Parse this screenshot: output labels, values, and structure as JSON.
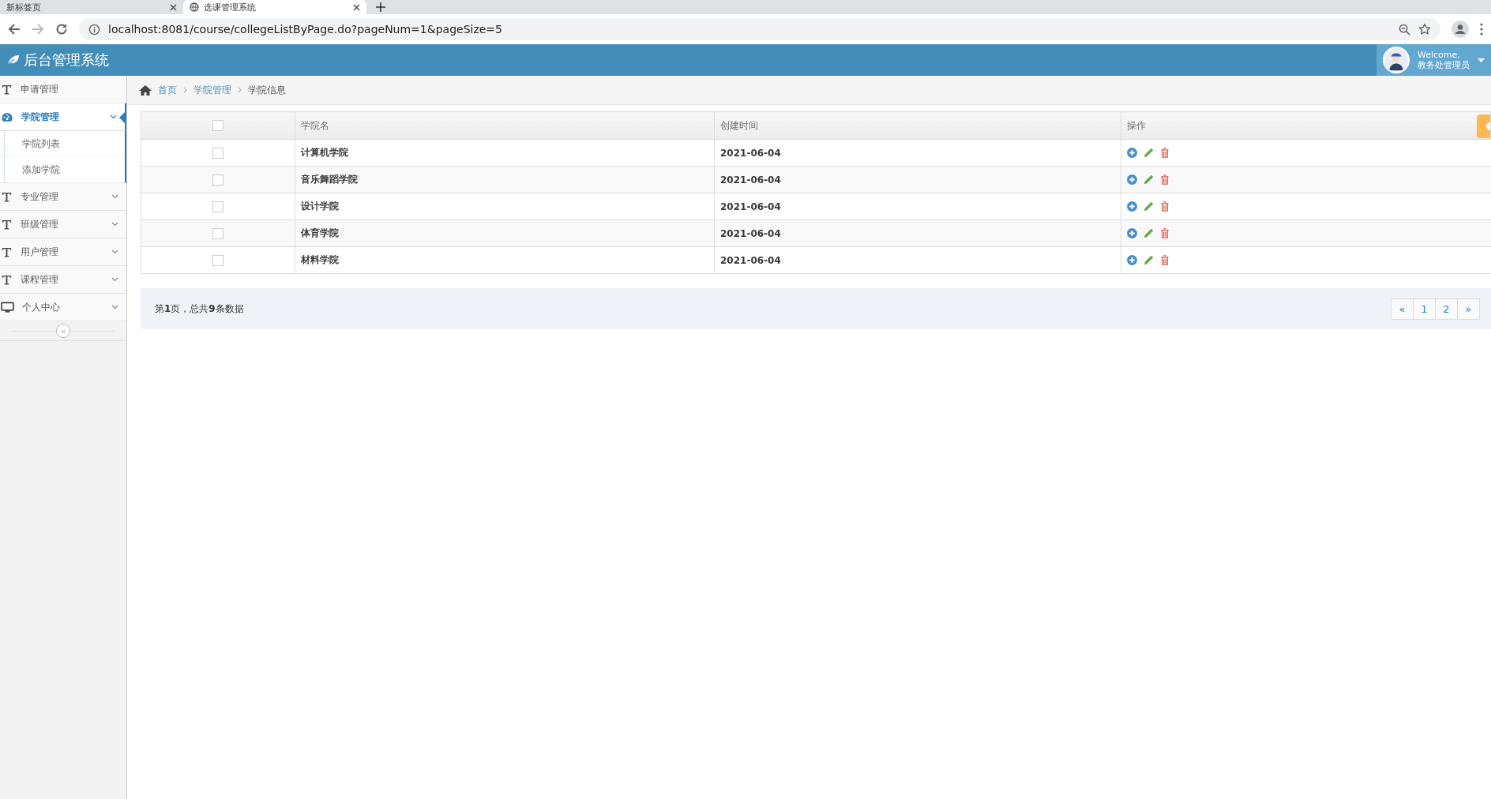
{
  "browser": {
    "tabs": [
      {
        "title": "新标签页",
        "selected": false
      },
      {
        "title": "选课管理系统",
        "selected": true
      }
    ],
    "address": "localhost:8081/course/collegeListByPage.do?pageNum=1&pageSize=5"
  },
  "header": {
    "title": "后台管理系统",
    "user": {
      "greeting": "Welcome,",
      "name": "教务处管理员"
    }
  },
  "sidebar": {
    "items": [
      {
        "label": "申请管理",
        "has_submenu": false,
        "selected": false
      },
      {
        "label": "学院管理",
        "has_submenu": true,
        "expanded": true,
        "selected": true,
        "children": [
          {
            "label": "学院列表"
          },
          {
            "label": "添加学院"
          }
        ]
      },
      {
        "label": "专业管理",
        "has_submenu": true,
        "expanded": false,
        "selected": false
      },
      {
        "label": "班级管理",
        "has_submenu": true,
        "expanded": false,
        "selected": false
      },
      {
        "label": "用户管理",
        "has_submenu": true,
        "expanded": false,
        "selected": false
      },
      {
        "label": "课程管理",
        "has_submenu": true,
        "expanded": false,
        "selected": false
      },
      {
        "label": "个人中心",
        "has_submenu": true,
        "expanded": false,
        "selected": false
      }
    ],
    "collapse": "«"
  },
  "breadcrumb": [
    {
      "label": "首页",
      "link": true
    },
    {
      "label": "学院管理",
      "link": true
    },
    {
      "label": "学院信息",
      "link": false
    }
  ],
  "table": {
    "columns": [
      "学院名",
      "创建时间",
      "操作"
    ],
    "header_checked": false,
    "rows": [
      {
        "name": "计算机学院",
        "created": "2021-06-04",
        "checked": false
      },
      {
        "name": "音乐舞蹈学院",
        "created": "2021-06-04",
        "checked": false
      },
      {
        "name": "设计学院",
        "created": "2021-06-04",
        "checked": false
      },
      {
        "name": "体育学院",
        "created": "2021-06-04",
        "checked": false
      },
      {
        "name": "材料学院",
        "created": "2021-06-04",
        "checked": false
      }
    ]
  },
  "pagination": {
    "summary": "第**1**页，总共**9**条数据",
    "pages": [
      "«",
      "1",
      "2",
      "»"
    ]
  }
}
